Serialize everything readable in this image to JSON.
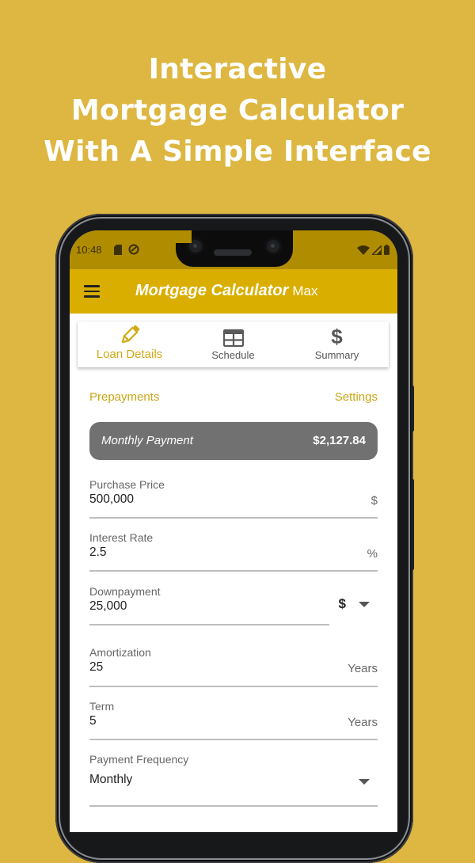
{
  "promo": {
    "lines": [
      "Interactive",
      "Mortgage Calculator",
      "With A Simple Interface"
    ]
  },
  "status_bar": {
    "time": "10:48",
    "left_icons": [
      "sd-card-icon",
      "sync-icon"
    ],
    "right_icons": [
      "wifi-icon",
      "signal-icon",
      "battery-icon"
    ]
  },
  "app_bar": {
    "menu_icon": "hamburger-menu-icon",
    "title": "Mortgage Calculator",
    "title_suffix": "Max",
    "color": "#DAAE00"
  },
  "tabs": [
    {
      "label": "Loan Details",
      "icon": "pencil-icon",
      "active": true
    },
    {
      "label": "Schedule",
      "icon": "table-icon",
      "active": false
    },
    {
      "label": "Summary",
      "icon": "dollar-icon",
      "active": false
    }
  ],
  "links": {
    "prepayments": "Prepayments",
    "settings": "Settings"
  },
  "payment_summary": {
    "label": "Monthly Payment",
    "value": "$2,127.84"
  },
  "fields": {
    "purchase_price": {
      "label": "Purchase Price",
      "value": "500,000",
      "suffix": "$"
    },
    "interest_rate": {
      "label": "Interest Rate",
      "value": "2.5",
      "suffix": "%"
    },
    "downpayment": {
      "label": "Downpayment",
      "value": "25,000",
      "unit_selected": "$"
    },
    "amortization": {
      "label": "Amortization",
      "value": "25",
      "suffix": "Years"
    },
    "term": {
      "label": "Term",
      "value": "5",
      "suffix": "Years"
    },
    "payment_frequency": {
      "label": "Payment Frequency",
      "value": "Monthly"
    }
  },
  "colors": {
    "background": "#DDB741",
    "accent": "#D0AB16",
    "status_bar": "#B08C00",
    "payment_box": "#717171"
  }
}
